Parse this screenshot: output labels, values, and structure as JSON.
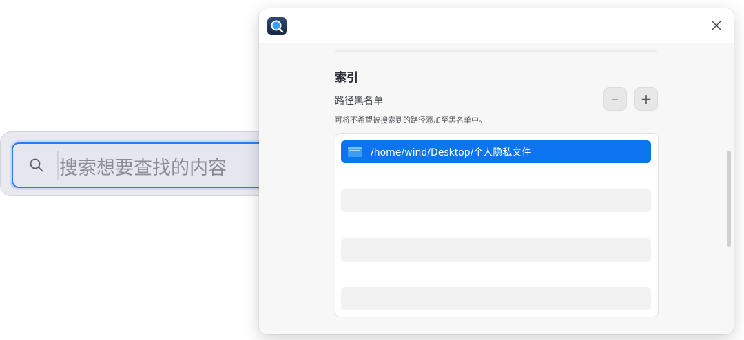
{
  "search": {
    "placeholder": "搜索想要查找的内容",
    "icon": "search-icon"
  },
  "dialog": {
    "app_icon": "search-app-icon",
    "close_icon": "close-icon",
    "section_title": "索引",
    "blacklist": {
      "label": "路径黑名单",
      "hint": "可将不希望被搜索到的路径添加至黑名单中。",
      "remove_button": "–",
      "add_button": "+",
      "items": [
        {
          "icon": "folder-icon",
          "path": "/home/wind/Desktop/个人隐私文件",
          "selected": true
        }
      ]
    }
  },
  "colors": {
    "accent": "#0d74f0",
    "search_border": "#2b7cf0"
  }
}
